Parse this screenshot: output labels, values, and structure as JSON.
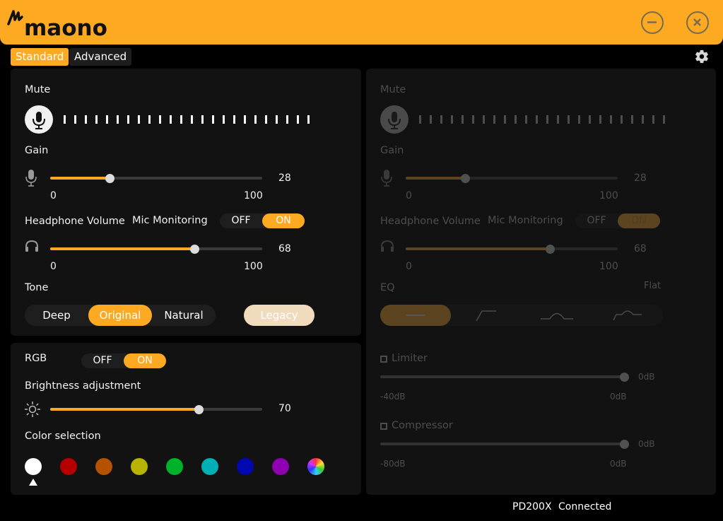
{
  "app": {
    "brand": "maono",
    "device": "PD200X",
    "status": "Connected"
  },
  "window": {
    "minimize_icon": "minus-circle-icon",
    "close_icon": "x-circle-icon",
    "settings_icon": "gear-icon"
  },
  "tabs": [
    {
      "label": "Standard",
      "active": true
    },
    {
      "label": "Advanced",
      "active": false
    }
  ],
  "left": {
    "mute": {
      "label": "Mute",
      "icon": "microphone-icon",
      "meter_ticks": 24
    },
    "gain": {
      "label": "Gain",
      "value": "28",
      "min": "0",
      "max": "100",
      "fraction": 0.28
    },
    "headphone": {
      "label": "Headphone Volume",
      "value": "68",
      "min": "0",
      "max": "100",
      "fraction": 0.68
    },
    "mic_monitoring": {
      "label": "Mic Monitoring",
      "off": "OFF",
      "on": "ON",
      "state": "ON"
    },
    "tone": {
      "label": "Tone",
      "options": [
        "Deep",
        "Original",
        "Natural"
      ],
      "selected": "Original",
      "legacy": "Legacy"
    },
    "rgb": {
      "label": "RGB",
      "off": "OFF",
      "on": "ON",
      "state": "ON"
    },
    "brightness": {
      "label": "Brightness adjustment",
      "value": "70",
      "fraction": 0.7
    },
    "color": {
      "label": "Color selection",
      "swatches": [
        "#ffffff",
        "#b50000",
        "#b45200",
        "#b8b300",
        "#00b12a",
        "#00b0b5",
        "#0008b0",
        "#8e00b0",
        "rainbow"
      ],
      "selected_index": 0
    }
  },
  "right": {
    "mute": {
      "label": "Mute"
    },
    "gain": {
      "label": "Gain",
      "value": "28",
      "min": "0",
      "max": "100",
      "fraction": 0.28
    },
    "headphone": {
      "label": "Headphone Volume",
      "value": "68",
      "min": "0",
      "max": "100",
      "fraction": 0.68
    },
    "mic_monitoring": {
      "label": "Mic Monitoring",
      "off": "OFF",
      "on": "ON"
    },
    "eq": {
      "label": "EQ",
      "preset": "Flat",
      "options": [
        "flat",
        "high-pass",
        "presence",
        "bass-presence"
      ],
      "selected_index": 0
    },
    "limiter": {
      "label": "Limiter",
      "value": "0dB",
      "min": "-40dB",
      "max": "0dB",
      "fraction": 1.0,
      "checked": false
    },
    "compressor": {
      "label": "Compressor",
      "value": "0dB",
      "min": "-80dB",
      "max": "0dB",
      "fraction": 1.0,
      "checked": false
    }
  }
}
